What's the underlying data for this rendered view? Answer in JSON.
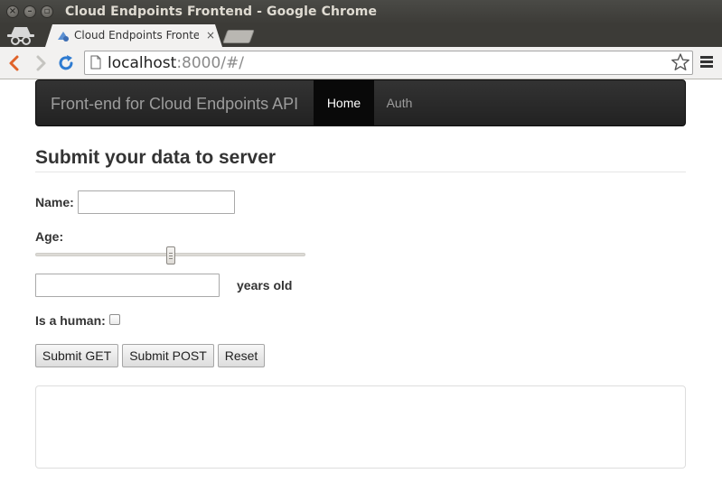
{
  "window": {
    "title": "Cloud Endpoints Frontend - Google Chrome",
    "close_glyph": "×",
    "minimize_glyph": "–",
    "maximize_glyph": "▫"
  },
  "browser": {
    "tab_title": "Cloud Endpoints Frontend",
    "tab_close_glyph": "×",
    "url_host": "localhost",
    "url_rest": ":8000/#/",
    "icons": [
      "incognito-icon",
      "favicon-icon",
      "back-icon",
      "forward-icon",
      "reload-icon",
      "page-icon",
      "star-icon",
      "menu-icon"
    ]
  },
  "navbar": {
    "brand": "Front-end for Cloud Endpoints API",
    "items": [
      {
        "label": "Home",
        "active": true
      },
      {
        "label": "Auth",
        "active": false
      }
    ]
  },
  "form": {
    "heading": "Submit your data to server",
    "name_label": "Name:",
    "name_value": "",
    "age_label": "Age:",
    "age_slider_fraction": 0.5,
    "age_value": "",
    "age_unit": "years old",
    "human_label": "Is a human:",
    "human_checked": false,
    "buttons": {
      "submit_get": "Submit GET",
      "submit_post": "Submit POST",
      "reset": "Reset"
    }
  },
  "output": {
    "text": ""
  },
  "colors": {
    "navbar": "#222222",
    "navbar_active": "#090909",
    "brand_text": "#9d9d9d",
    "reload_blue": "#2e7bd1",
    "back_orange": "#e0632a"
  }
}
